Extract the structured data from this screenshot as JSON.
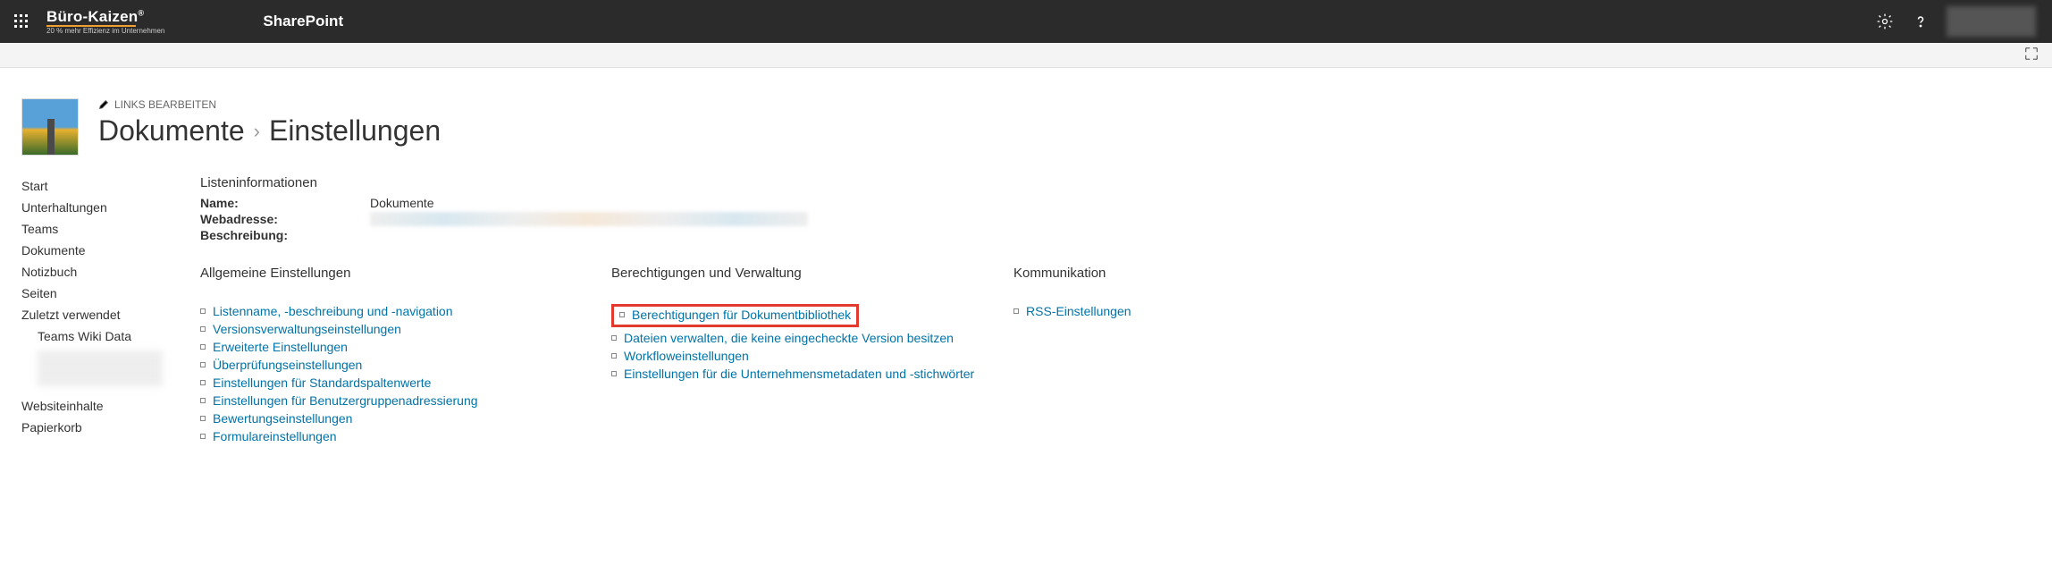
{
  "suitebar": {
    "brand_name": "Büro-Kaizen",
    "brand_reg": "®",
    "brand_tagline": "20 % mehr Effizienz im Unternehmen",
    "app_title": "SharePoint"
  },
  "header": {
    "edit_links_label": "LINKS BEARBEITEN",
    "crumb_parent": "Dokumente",
    "crumb_current": "Einstellungen"
  },
  "nav": {
    "items": [
      "Start",
      "Unterhaltungen",
      "Teams",
      "Dokumente",
      "Notizbuch",
      "Seiten",
      "Zuletzt verwendet"
    ],
    "sub_item": "Teams Wiki Data",
    "footer_items": [
      "Websiteinhalte",
      "Papierkorb"
    ]
  },
  "listinfo": {
    "heading": "Listeninformationen",
    "name_label": "Name:",
    "name_value": "Dokumente",
    "url_label": "Webadresse:",
    "desc_label": "Beschreibung:"
  },
  "cols": {
    "general": {
      "heading": "Allgemeine Einstellungen",
      "links": [
        "Listenname, -beschreibung und -navigation",
        "Versionsverwaltungseinstellungen",
        "Erweiterte Einstellungen",
        "Überprüfungseinstellungen",
        "Einstellungen für Standardspaltenwerte",
        "Einstellungen für Benutzergruppenadressierung",
        "Bewertungseinstellungen",
        "Formulareinstellungen"
      ]
    },
    "perms": {
      "heading": "Berechtigungen und Verwaltung",
      "highlighted": "Berechtigungen für Dokumentbibliothek",
      "links": [
        "Dateien verwalten, die keine eingecheckte Version besitzen",
        "Workfloweinstellungen",
        "Einstellungen für die Unternehmensmetadaten und -stichwörter"
      ]
    },
    "comm": {
      "heading": "Kommunikation",
      "links": [
        "RSS-Einstellungen"
      ]
    }
  }
}
